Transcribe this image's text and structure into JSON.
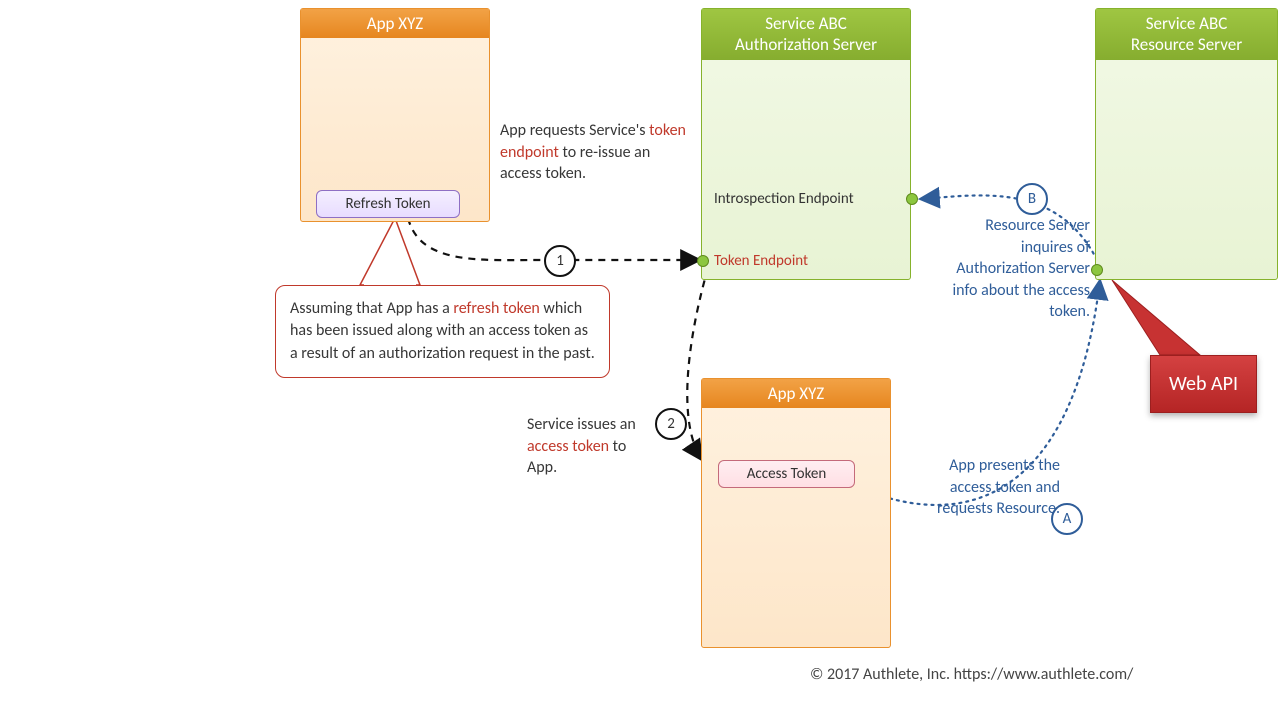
{
  "boxes": {
    "app1_title": "App XYZ",
    "app2_title": "App XYZ",
    "auth_title_l1": "Service ABC",
    "auth_title_l2": "Authorization Server",
    "res_title_l1": "Service ABC",
    "res_title_l2": "Resource Server"
  },
  "tokens": {
    "refresh": "Refresh Token",
    "access": "Access Token"
  },
  "endpoints": {
    "introspection": "Introspection Endpoint",
    "token_pre": "Token Endpoint"
  },
  "steps": {
    "s1": "1",
    "s2": "2",
    "sA": "A",
    "sB": "B"
  },
  "texts": {
    "req_pre": "App requests Service's ",
    "req_red": "token endpoint",
    "req_post": " to re-issue an access token.",
    "callout_pre": "Assuming that App has a ",
    "callout_red": "refresh token",
    "callout_post": " which has been issued along with an access token as a result of an authorization request in the past.",
    "issue_pre": "Service issues an ",
    "issue_red": "access token",
    "issue_post": " to App.",
    "presentsA": "App presents the access token and requests Resource.",
    "inquiresB": "Resource Server inquires of Authorization Server info about the access token."
  },
  "webapi": "Web API",
  "copyright": "© 2017 Authlete, Inc.  https://www.authlete.com/"
}
